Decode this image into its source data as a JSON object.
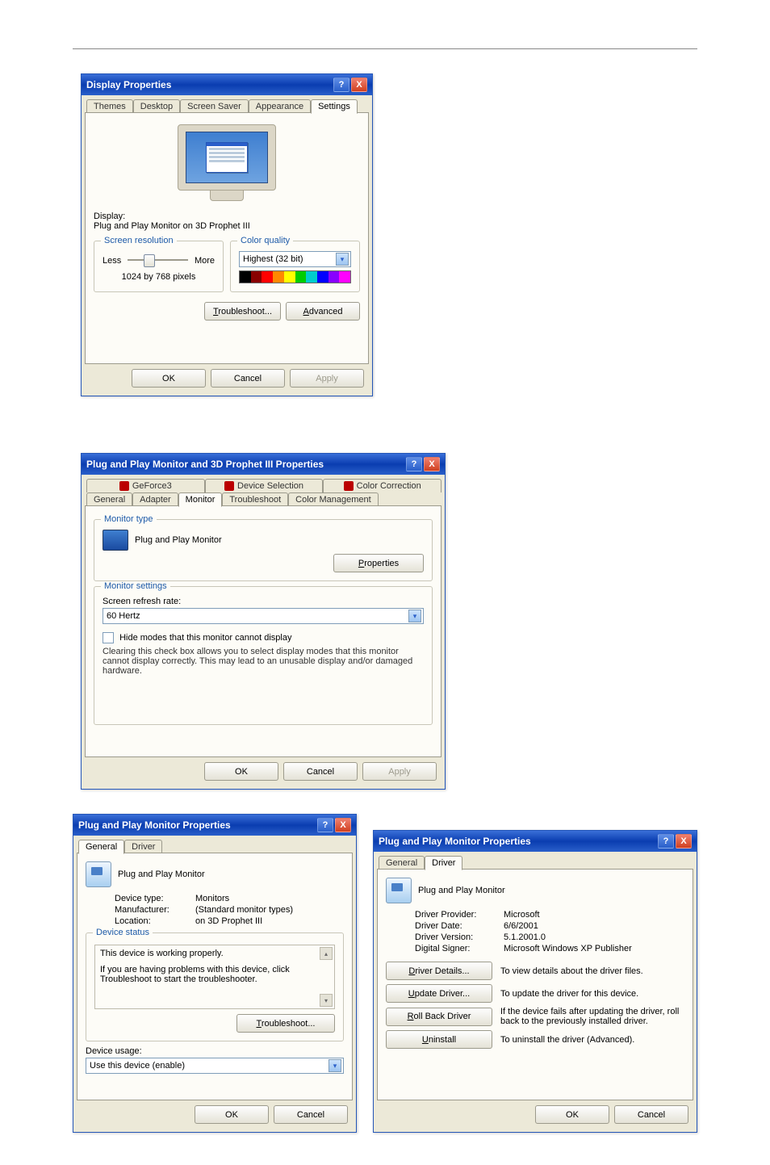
{
  "dialog1": {
    "title": "Display Properties",
    "help": "?",
    "close": "X",
    "tabs": [
      "Themes",
      "Desktop",
      "Screen Saver",
      "Appearance",
      "Settings"
    ],
    "activeTab": "Settings",
    "displayLabel": "Display:",
    "displayValue": "Plug and Play Monitor on 3D Prophet III",
    "resGroup": "Screen resolution",
    "resLess": "Less",
    "resMore": "More",
    "resValue": "1024 by 768 pixels",
    "colorGroup": "Color quality",
    "colorValue": "Highest (32 bit)",
    "troubleshoot": "Troubleshoot...",
    "advanced": "Advanced",
    "ok": "OK",
    "cancel": "Cancel",
    "apply": "Apply"
  },
  "dialog2": {
    "title": "Plug and Play Monitor and 3D Prophet III Properties",
    "help": "?",
    "close": "X",
    "tabRow1": [
      "GeForce3",
      "Device Selection",
      "Color Correction"
    ],
    "tabRow2": [
      "General",
      "Adapter",
      "Monitor",
      "Troubleshoot",
      "Color Management"
    ],
    "activeTab": "Monitor",
    "monTypeGroup": "Monitor type",
    "monTypeValue": "Plug and Play Monitor",
    "propsBtn": "Properties",
    "monSettingsGroup": "Monitor settings",
    "refreshLabel": "Screen refresh rate:",
    "refreshValue": "60 Hertz",
    "hideModes": "Hide modes that this monitor cannot display",
    "hideModesDesc": "Clearing this check box allows you to select display modes that this monitor cannot display correctly. This may lead to an unusable display and/or damaged hardware.",
    "ok": "OK",
    "cancel": "Cancel",
    "apply": "Apply"
  },
  "dialog3": {
    "title": "Plug and Play Monitor Properties",
    "help": "?",
    "close": "X",
    "tabs": [
      "General",
      "Driver"
    ],
    "activeTab": "General",
    "deviceName": "Plug and Play Monitor",
    "deviceTypeLabel": "Device type:",
    "deviceTypeValue": "Monitors",
    "manufLabel": "Manufacturer:",
    "manufValue": "(Standard monitor types)",
    "locLabel": "Location:",
    "locValue": "on 3D Prophet III",
    "statusGroup": "Device status",
    "statusLine1": "This device is working properly.",
    "statusLine2": "If you are having problems with this device, click Troubleshoot to start the troubleshooter.",
    "troubleshoot": "Troubleshoot...",
    "usageLabel": "Device usage:",
    "usageValue": "Use this device (enable)",
    "ok": "OK",
    "cancel": "Cancel"
  },
  "dialog4": {
    "title": "Plug and Play Monitor Properties",
    "help": "?",
    "close": "X",
    "tabs": [
      "General",
      "Driver"
    ],
    "activeTab": "Driver",
    "deviceName": "Plug and Play Monitor",
    "providerLabel": "Driver Provider:",
    "providerValue": "Microsoft",
    "dateLabel": "Driver Date:",
    "dateValue": "6/6/2001",
    "versionLabel": "Driver Version:",
    "versionValue": "5.1.2001.0",
    "signerLabel": "Digital Signer:",
    "signerValue": "Microsoft Windows XP Publisher",
    "detailsBtn": "Driver Details...",
    "detailsDesc": "To view details about the driver files.",
    "updateBtn": "Update Driver...",
    "updateDesc": "To update the driver for this device.",
    "rollbackBtn": "Roll Back Driver",
    "rollbackDesc": "If the device fails after updating the driver, roll back to the previously installed driver.",
    "uninstallBtn": "Uninstall",
    "uninstallDesc": "To uninstall the driver (Advanced).",
    "ok": "OK",
    "cancel": "Cancel"
  },
  "chart_data": null
}
